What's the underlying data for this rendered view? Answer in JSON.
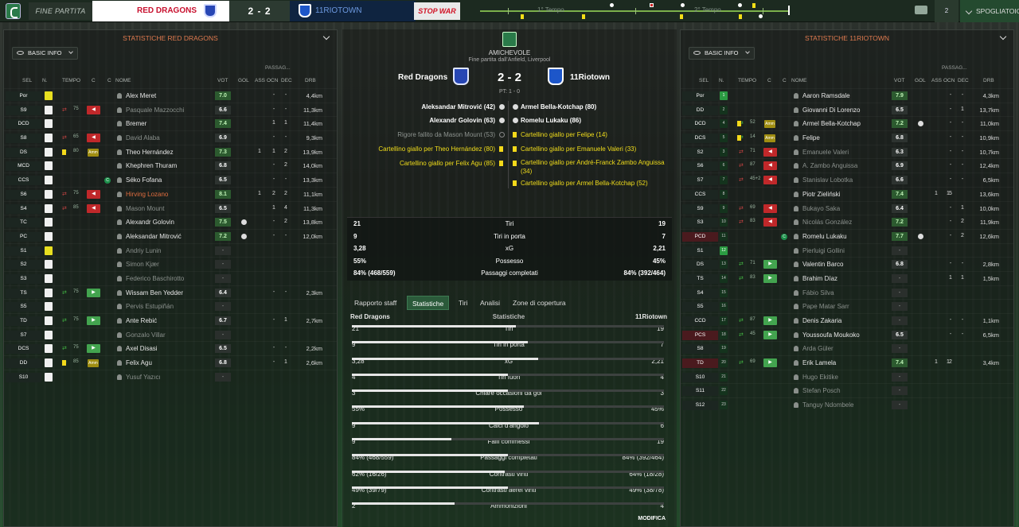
{
  "topbar": {
    "fine": "FINE PARTITA",
    "home": "RED DRAGONS",
    "score": "2 - 2",
    "away": "11RIOTOWN",
    "stop": "STOP WAR",
    "h1": "1° Tempo",
    "h2": "2° Tempo",
    "count": "2",
    "spogliatoio": "SPOGLIATOIO"
  },
  "left": {
    "title": "STATISTICHE RED DRAGONS",
    "basic": "BASIC INFO",
    "passaggi": "PASSAG..."
  },
  "right": {
    "title": "STATISTICHE 11RIOTOWN",
    "basic": "BASIC INFO",
    "passaggi": "PASSAG..."
  },
  "headers": {
    "sel": "SEL",
    "n": "N.",
    "tempo": "TEMPO",
    "c": "C",
    "nome": "NOME",
    "vot": "VOT",
    "gol": "GOL",
    "ass": "ASS",
    "ocn": "OCN",
    "dec": "DEC",
    "drb": "DRB"
  },
  "home_players": [
    {
      "pos": "Por",
      "name": "Alex Meret",
      "vot": "7.0",
      "ocn": "-",
      "dec": "-",
      "gol": "",
      "ass": "",
      "drb": "4,4km",
      "gk": true
    },
    {
      "pos": "S9",
      "name": "Pasquale Mazzocchi",
      "vot": "6.6",
      "tm": "75",
      "out": true,
      "dim": true,
      "ocn": "-",
      "dec": "-",
      "drb": "11,3km"
    },
    {
      "pos": "DCD",
      "name": "Bremer",
      "vot": "7.4",
      "ocn": "1",
      "dec": "1",
      "drb": "11,4km"
    },
    {
      "pos": "S8",
      "name": "David Alaba",
      "vot": "6.9",
      "tm": "65",
      "out": true,
      "dim": true,
      "ocn": "-",
      "dec": "-",
      "drb": "9,3km"
    },
    {
      "pos": "DS",
      "name": "Theo Hernández",
      "vot": "7.3",
      "tm": "80",
      "yc": true,
      "amm": true,
      "gol": "1",
      "ocn": "1",
      "dec": "2",
      "drb": "13,9km"
    },
    {
      "pos": "MCD",
      "name": "Khephren Thuram",
      "vot": "6.8",
      "ocn": "-",
      "dec": "2",
      "drb": "14,0km"
    },
    {
      "pos": "CCS",
      "name": "Séko Fofana",
      "vot": "6.5",
      "cap": true,
      "ocn": "-",
      "dec": "-",
      "drb": "13,3km"
    },
    {
      "pos": "S6",
      "name": "Hirving Lozano",
      "vot": "8.1",
      "tm": "75",
      "out": true,
      "hi": true,
      "gol": "1",
      "ocn": "2",
      "dec": "2",
      "drb": "11,1km"
    },
    {
      "pos": "S4",
      "name": "Mason Mount",
      "vot": "6.5",
      "tm": "85",
      "out": true,
      "dim": true,
      "ocn": "1",
      "dec": "4",
      "drb": "11,3km"
    },
    {
      "pos": "TC",
      "name": "Alexandr Golovin",
      "vot": "7.5",
      "ball": true,
      "ocn": "-",
      "dec": "2",
      "drb": "13,8km"
    },
    {
      "pos": "PC",
      "name": "Aleksandar Mitrović",
      "vot": "7.2",
      "ball": true,
      "ocn": "-",
      "dec": "-",
      "drb": "12,0km"
    },
    {
      "pos": "S1",
      "name": "Andriy Lunin",
      "vot": "-",
      "gk": true,
      "dim": true
    },
    {
      "pos": "S2",
      "name": "Simon Kjær",
      "vot": "-",
      "dim": true
    },
    {
      "pos": "S3",
      "name": "Federico Baschirotto",
      "vot": "-",
      "dim": true
    },
    {
      "pos": "TS",
      "name": "Wissam Ben Yedder",
      "vot": "6.4",
      "tm": "75",
      "in": true,
      "ocn": "-",
      "dec": "-",
      "drb": "2,3km"
    },
    {
      "pos": "S5",
      "name": "Pervis Estupiñán",
      "vot": "-",
      "dim": true
    },
    {
      "pos": "TD",
      "name": "Ante Rebić",
      "vot": "6.7",
      "tm": "75",
      "in": true,
      "ocn": "-",
      "dec": "1",
      "drb": "2,7km"
    },
    {
      "pos": "S7",
      "name": "Gonzalo Villar",
      "vot": "-",
      "dim": true
    },
    {
      "pos": "DCS",
      "name": "Axel Disasi",
      "vot": "6.5",
      "tm": "75",
      "in": true,
      "ocn": "-",
      "dec": "-",
      "drb": "2,2km"
    },
    {
      "pos": "DD",
      "name": "Felix Agu",
      "vot": "6.8",
      "tm": "85",
      "yc": true,
      "amm": true,
      "ocn": "-",
      "dec": "1",
      "drb": "2,6km"
    },
    {
      "pos": "S10",
      "name": "Yusuf Yazıcı",
      "vot": "-",
      "dim": true
    }
  ],
  "away_players": [
    {
      "pos": "Por",
      "n": "1",
      "name": "Aaron Ramsdale",
      "vot": "7.9",
      "ocn": "-",
      "dec": "-",
      "drb": "4,3km",
      "gk": true
    },
    {
      "pos": "DD",
      "n": "2",
      "name": "Giovanni Di Lorenzo",
      "vot": "6.5",
      "ocn": "-",
      "dec": "1",
      "drb": "13,7km"
    },
    {
      "pos": "DCD",
      "n": "4",
      "name": "Armel Bella-Kotchap",
      "vot": "7.2",
      "tm": "52",
      "yc": true,
      "amm": true,
      "ball": true,
      "ocn": "-",
      "dec": "-",
      "drb": "11,0km"
    },
    {
      "pos": "DCS",
      "n": "5",
      "name": "Felipe",
      "vot": "6.8",
      "tm": "14",
      "yc": true,
      "amm": true,
      "ocn": "-",
      "dec": "-",
      "drb": "10,9km"
    },
    {
      "pos": "S2",
      "n": "3",
      "name": "Emanuele Valeri",
      "vot": "6.3",
      "tm": "71",
      "out": true,
      "dim": true,
      "ocn": "-",
      "dec": "-",
      "drb": "10,7km"
    },
    {
      "pos": "S6",
      "n": "6",
      "name": "A. Zambo Anguissa",
      "vot": "6.9",
      "tm": "87",
      "out": true,
      "dim": true,
      "ocn": "-",
      "dec": "-",
      "drb": "12,4km"
    },
    {
      "pos": "S7",
      "n": "7",
      "name": "Stanislav Lobotka",
      "vot": "6.6",
      "tm": "45+2",
      "out": true,
      "dim": true,
      "ocn": "-",
      "dec": "-",
      "drb": "6,5km"
    },
    {
      "pos": "CCS",
      "n": "8",
      "name": "Piotr Zieliński",
      "vot": "7.4",
      "gol": "1",
      "ass": "1",
      "ocn": "5",
      "dec": "",
      "drb": "13,6km"
    },
    {
      "pos": "S9",
      "n": "9",
      "name": "Bukayo Saka",
      "vot": "6.4",
      "tm": "69",
      "out": true,
      "dim": true,
      "ocn": "-",
      "dec": "1",
      "drb": "10,0km"
    },
    {
      "pos": "S3",
      "n": "10",
      "name": "Nicolás González",
      "vot": "7.2",
      "tm": "83",
      "out": true,
      "dim": true,
      "ocn": "-",
      "dec": "2",
      "drb": "11,9km"
    },
    {
      "pos": "PCD",
      "n": "11",
      "name": "Romelu Lukaku",
      "vot": "7.7",
      "cap": true,
      "ball": true,
      "ocn": "-",
      "dec": "2",
      "drb": "12,6km",
      "red": true
    },
    {
      "pos": "S1",
      "n": "12",
      "name": "Pierluigi Gollini",
      "vot": "-",
      "gk": true,
      "dim": true
    },
    {
      "pos": "DS",
      "n": "13",
      "name": "Valentin Barco",
      "vot": "6.8",
      "tm": "71",
      "in": true,
      "ocn": "-",
      "dec": "-",
      "drb": "2,8km"
    },
    {
      "pos": "TS",
      "n": "14",
      "name": "Brahim Díaz",
      "vot": "-",
      "tm": "83",
      "in": true,
      "ocn": "1",
      "dec": "1",
      "drb": "1,5km"
    },
    {
      "pos": "S4",
      "n": "15",
      "name": "Fábio Silva",
      "vot": "-",
      "dim": true
    },
    {
      "pos": "S5",
      "n": "16",
      "name": "Pape Matar Sarr",
      "vot": "-",
      "dim": true
    },
    {
      "pos": "CCD",
      "n": "17",
      "name": "Denis Zakaria",
      "vot": "-",
      "tm": "87",
      "in": true,
      "ocn": "-",
      "dec": "-",
      "drb": "1,1km"
    },
    {
      "pos": "PCS",
      "n": "18",
      "name": "Youssoufa Moukoko",
      "vot": "6.5",
      "tm": "45",
      "in": true,
      "ocn": "-",
      "dec": "-",
      "drb": "6,5km",
      "red": true
    },
    {
      "pos": "S8",
      "n": "19",
      "name": "Arda Güler",
      "vot": "-",
      "dim": true
    },
    {
      "pos": "TD",
      "n": "20",
      "name": "Erik Lamela",
      "vot": "7.4",
      "tm": "69",
      "in": true,
      "gol": "1",
      "ass": "1",
      "ocn": "2",
      "dec": "",
      "drb": "3,4km",
      "red": true
    },
    {
      "pos": "S10",
      "n": "21",
      "name": "Hugo Ekitike",
      "vot": "-",
      "dim": true
    },
    {
      "pos": "S11",
      "n": "22",
      "name": "Stefan Posch",
      "vot": "-",
      "dim": true
    },
    {
      "pos": "S12",
      "n": "23",
      "name": "Tanguy Ndombele",
      "vot": "-",
      "dim": true
    }
  ],
  "center": {
    "competition": "AMICHEVOLE",
    "venue": "Fine partita dall'Anfield, Liverpool",
    "home": "Red Dragons",
    "score": "2 - 2",
    "away": "11Riotown",
    "pt": "PT: 1 - 0",
    "home_events": [
      {
        "t": "Aleksandar Mitrović (42)",
        "k": "goal"
      },
      {
        "t": "Alexandr Golovin (63)",
        "k": "goal"
      },
      {
        "t": "Rigore fallito da Mason Mount (53)",
        "k": "miss"
      },
      {
        "t": "Cartellino giallo per Theo Hernández (80)",
        "k": "card"
      },
      {
        "t": "Cartellino giallo per Felix Agu (85)",
        "k": "card"
      }
    ],
    "away_events": [
      {
        "t": "Armel Bella-Kotchap (80)",
        "k": "goal"
      },
      {
        "t": "Romelu Lukaku (86)",
        "k": "goal"
      },
      {
        "t": "Cartellino giallo per Felipe (14)",
        "k": "card"
      },
      {
        "t": "Cartellino giallo per Emanuele Valeri (33)",
        "k": "card"
      },
      {
        "t": "Cartellino giallo per André-Franck Zambo Anguissa (34)",
        "k": "card"
      },
      {
        "t": "Cartellino giallo per Armel Bella-Kotchap (52)",
        "k": "card"
      }
    ],
    "summary": [
      {
        "l": "21",
        "n": "Tiri",
        "r": "19"
      },
      {
        "l": "9",
        "n": "Tiri in porta",
        "r": "7"
      },
      {
        "l": "3,28",
        "n": "xG",
        "r": "2,21"
      },
      {
        "l": "55%",
        "n": "Possesso",
        "r": "45%"
      },
      {
        "l": "84% (468/559)",
        "n": "Passaggi completati",
        "r": "84% (392/464)"
      }
    ],
    "tabs": [
      "Rapporto staff",
      "Statistiche",
      "Tiri",
      "Analisi",
      "Zone di copertura"
    ],
    "det_head": {
      "l": "Red Dragons",
      "c": "Statistiche",
      "r": "11Riotown"
    },
    "details": [
      {
        "l": "21",
        "n": "Tiri",
        "r": "19",
        "f": 0.525
      },
      {
        "l": "9",
        "n": "Tiri in porta",
        "r": "7",
        "f": 0.5625
      },
      {
        "l": "3,28",
        "n": "xG",
        "r": "2,21",
        "f": 0.597
      },
      {
        "l": "4",
        "n": "Tiri fuori",
        "r": "4",
        "f": 0.5
      },
      {
        "l": "3",
        "n": "Chiare occasioni da gol",
        "r": "3",
        "f": 0.5
      },
      {
        "l": "55%",
        "n": "Possesso",
        "r": "45%",
        "f": 0.55
      },
      {
        "l": "9",
        "n": "Calci d'angolo",
        "r": "6",
        "f": 0.6
      },
      {
        "l": "9",
        "n": "Falli commessi",
        "r": "19",
        "f": 0.32
      },
      {
        "l": "84% (468/559)",
        "n": "Passaggi completati",
        "r": "84% (392/464)",
        "f": 0.5
      },
      {
        "l": "62% (16/26)",
        "n": "Contrasti vinti",
        "r": "64% (18/28)",
        "f": 0.49
      },
      {
        "l": "49% (39/79)",
        "n": "Contrasti aerei vinti",
        "r": "49% (38/78)",
        "f": 0.5
      },
      {
        "l": "2",
        "n": "Ammonizioni",
        "r": "4",
        "f": 0.33
      }
    ],
    "modifica": "MODIFICA"
  },
  "colors": {
    "accent": "#2b5a3a",
    "home_red": "#c8102e",
    "title_orange": "#e07a4f",
    "card_yellow": "#f1dd1b"
  }
}
